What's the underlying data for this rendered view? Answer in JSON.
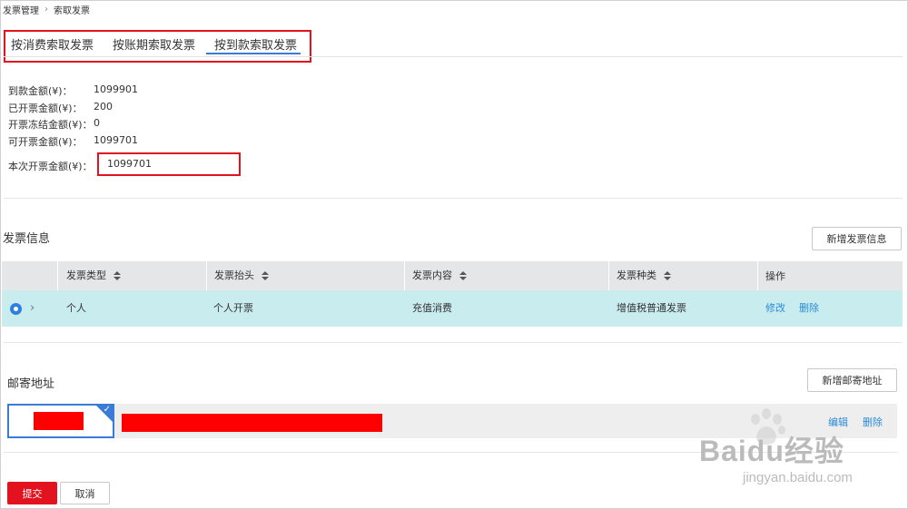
{
  "breadcrumb": {
    "parent": "发票管理",
    "separator": "›",
    "current": "索取发票"
  },
  "tabs": [
    {
      "label": "按消费索取发票",
      "active": false
    },
    {
      "label": "按账期索取发票",
      "active": false
    },
    {
      "label": "按到款索取发票",
      "active": true
    }
  ],
  "summary": [
    {
      "label": "到款金额(¥)：",
      "value": "1099901"
    },
    {
      "label": "已开票金额(¥)：",
      "value": "200"
    },
    {
      "label": "开票冻结金额(¥)：",
      "value": "0"
    },
    {
      "label": "可开票金额(¥)：",
      "value": "1099701"
    }
  ],
  "current_amount": {
    "label": "本次开票金额(¥)：",
    "value": "1099701"
  },
  "invoice_info": {
    "title": "发票信息",
    "add_button": "新增发票信息",
    "columns": [
      "发票类型",
      "发票抬头",
      "发票内容",
      "发票种类",
      "操作"
    ],
    "rows": [
      {
        "type": "个人",
        "header": "个人开票",
        "content": "充值消费",
        "kind": "增值税普通发票",
        "edit": "修改",
        "delete": "删除",
        "selected": true
      }
    ]
  },
  "mailing": {
    "title": "邮寄地址",
    "add_button": "新增邮寄地址",
    "edit": "编辑",
    "delete": "删除",
    "check_icon": "checkmark-icon"
  },
  "actions": {
    "submit": "提交",
    "cancel": "取消"
  },
  "watermark": {
    "brand": "Baidu经验",
    "url": "jingyan.baidu.com"
  },
  "colors": {
    "accent_red": "#e3121f",
    "link_blue": "#2b8bd8",
    "selected_row": "#c9ecef",
    "table_header": "#e5e6e8",
    "tab_underline": "#3a7bd5"
  }
}
